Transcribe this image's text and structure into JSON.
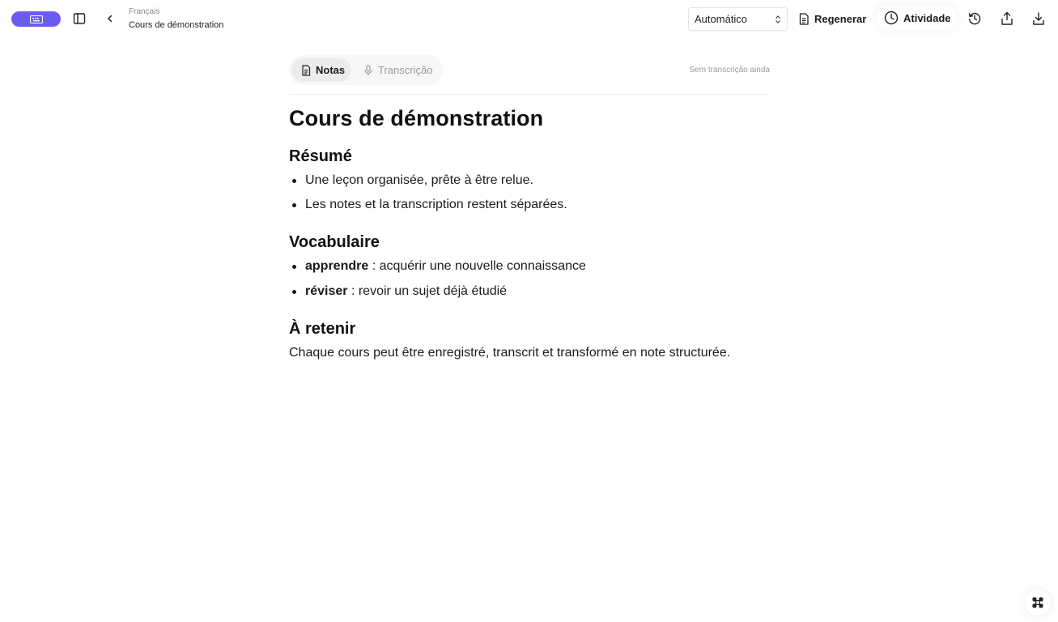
{
  "colors": {
    "brand": "#6b5cf0",
    "text": "#111111",
    "muted": "#9a9a9a"
  },
  "header": {
    "brand_icon": "keyboard-icon",
    "breadcrumb": {
      "parent": "Français",
      "title": "Cours de démonstration"
    },
    "mode_select": {
      "value": "Automático"
    },
    "regenerate_label": "Regenerar",
    "activity_label": "Atividade",
    "icons": [
      "sidebar-toggle-icon",
      "chevron-left-icon",
      "file-text-icon",
      "clock-icon",
      "history-icon",
      "share-icon",
      "download-icon"
    ]
  },
  "tabs": [
    {
      "label": "Notas",
      "icon": "file-text-icon",
      "active": true
    },
    {
      "label": "Transcrição",
      "icon": "microphone-icon",
      "active": false
    }
  ],
  "status": "Sem transcrição ainda",
  "document": {
    "title": "Cours de démonstration",
    "sections": [
      {
        "heading": "Résumé",
        "bullets": [
          "Une leçon organisée, prête à être relue.",
          "Les notes et la transcription restent séparées."
        ]
      },
      {
        "heading": "Vocabulaire",
        "terms": [
          {
            "term": "apprendre",
            "definition": " : acquérir une nouvelle connaissance"
          },
          {
            "term": "réviser",
            "definition": " : revoir un sujet déjà étudié"
          }
        ]
      },
      {
        "heading": "À retenir",
        "paragraph": "Chaque cours peut être enregistré, transcrit et transformé en note structurée."
      }
    ]
  },
  "fab_icon": "command-icon"
}
